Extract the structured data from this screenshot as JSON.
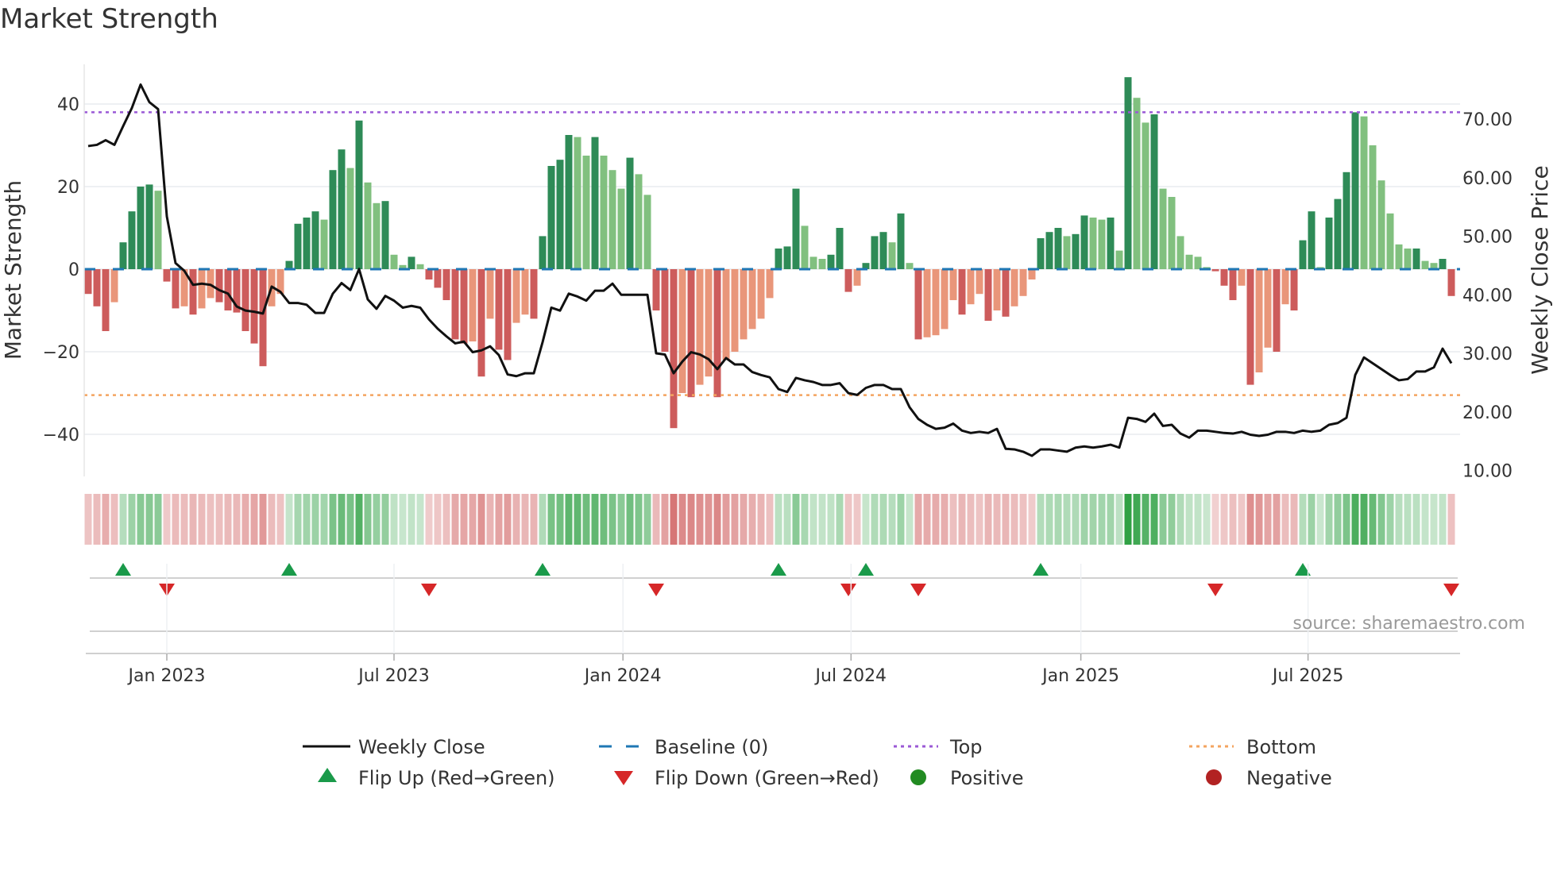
{
  "title": "Market Strength",
  "source": "source: sharemaestro.com",
  "chart_data": {
    "type": "bar",
    "title": "Market Strength",
    "ylabel": "Market Strength",
    "y2label": "Weekly Close Price",
    "ylim": [
      -50,
      50
    ],
    "y2lim": [
      10,
      78
    ],
    "yticks": [
      "40",
      "20",
      "0",
      "−20",
      "−40"
    ],
    "ytick_values": [
      40,
      20,
      0,
      -20,
      -40
    ],
    "y2ticks": [
      "70.00",
      "60.00",
      "50.00",
      "40.00",
      "30.00",
      "20.00",
      "10.00"
    ],
    "y2tick_values": [
      70,
      60,
      50,
      40,
      30,
      20,
      10
    ],
    "xticks": [
      {
        "label": "Jan 2023",
        "week": 9
      },
      {
        "label": "Jul 2023",
        "week": 35
      },
      {
        "label": "Jan 2024",
        "week": 61.2
      },
      {
        "label": "Jul 2024",
        "week": 87.3
      },
      {
        "label": "Jan 2025",
        "week": 113.6
      },
      {
        "label": "Jul 2025",
        "week": 139.6
      }
    ],
    "top_level": 38,
    "bottom_level": -30.5,
    "baseline": 0,
    "strength": [
      -6,
      -9,
      -15,
      -8,
      6.5,
      14,
      20,
      20.5,
      19,
      -3,
      -9.5,
      -9,
      -11,
      -9.5,
      -7,
      -8,
      -10,
      -10.5,
      -15,
      -18,
      -23.5,
      -9,
      -6,
      2,
      11,
      12.5,
      14,
      12,
      24,
      29,
      24.5,
      36,
      21,
      16,
      16.5,
      3.5,
      1,
      3,
      1.2,
      -2.5,
      -4.5,
      -7.5,
      -17,
      -18,
      -17.5,
      -26,
      -12,
      -19.5,
      -22,
      -13,
      -11,
      -12,
      8,
      25,
      26.5,
      32.5,
      32,
      27.5,
      32,
      27.5,
      24,
      19.5,
      27,
      23,
      18,
      -10,
      -20,
      -38.5,
      -30,
      -31,
      -28,
      -26,
      -31,
      -22,
      -20,
      -17,
      -14.5,
      -12,
      -7,
      5,
      5.5,
      19.5,
      10.5,
      3,
      2.5,
      3.5,
      10,
      -5.5,
      -4,
      1.5,
      8,
      9,
      6.5,
      13.5,
      1.5,
      -17,
      -16.5,
      -16,
      -14.5,
      -7.5,
      -11,
      -8.5,
      -6,
      -12.5,
      -10,
      -11.5,
      -9,
      -6.5,
      -2.5,
      7.5,
      9,
      10,
      8,
      8.5,
      13,
      12.5,
      12,
      12.5,
      4.5,
      46.5,
      41.5,
      35.5,
      37.5,
      19.5,
      17.5,
      8,
      3.5,
      3,
      0.5,
      -0.5,
      -4,
      -7.5,
      -4,
      -28,
      -25,
      -19,
      -20,
      -8.5,
      -10,
      7,
      14,
      0.5,
      12.5,
      17,
      23.5,
      38,
      37,
      30,
      21.5,
      13.5,
      6,
      5,
      5,
      2,
      1.5,
      2.5,
      -6.5
    ],
    "weekly_close": [
      65.4,
      65.6,
      66.4,
      65.6,
      68.8,
      71.9,
      75.9,
      72.9,
      71.7,
      53.4,
      45.4,
      44.1,
      41.7,
      41.9,
      41.7,
      40.8,
      40.2,
      38.0,
      37.3,
      37.1,
      36.8,
      41.4,
      40.5,
      38.6,
      38.6,
      38.3,
      36.9,
      36.9,
      40.2,
      42.0,
      40.8,
      44.4,
      39.2,
      37.6,
      39.8,
      39.0,
      37.8,
      38.1,
      37.8,
      35.8,
      34.2,
      32.9,
      31.7,
      32.0,
      30.2,
      30.5,
      31.2,
      29.7,
      26.4,
      26.1,
      26.6,
      26.6,
      31.9,
      37.8,
      37.3,
      40.2,
      39.7,
      39.0,
      40.7,
      40.7,
      41.9,
      40.0,
      40.0,
      40.0,
      40.0,
      30.0,
      29.8,
      26.6,
      28.6,
      30.2,
      29.8,
      29.0,
      27.3,
      29.2,
      28.1,
      28.1,
      26.8,
      26.3,
      25.9,
      23.9,
      23.4,
      25.8,
      25.4,
      25.1,
      24.6,
      24.6,
      24.9,
      23.2,
      22.9,
      24.1,
      24.6,
      24.6,
      23.9,
      23.9,
      20.8,
      18.8,
      17.8,
      17.1,
      17.3,
      18.0,
      16.8,
      16.4,
      16.6,
      16.4,
      17.1,
      13.7,
      13.6,
      13.2,
      12.5,
      13.6,
      13.6,
      13.4,
      13.2,
      13.9,
      14.1,
      13.9,
      14.1,
      14.4,
      13.9,
      19.0,
      18.8,
      18.3,
      19.7,
      17.6,
      17.8,
      16.3,
      15.6,
      16.8,
      16.8,
      16.6,
      16.4,
      16.3,
      16.6,
      16.1,
      15.9,
      16.1,
      16.6,
      16.6,
      16.4,
      16.8,
      16.6,
      16.8,
      17.8,
      18.1,
      19.0,
      26.3,
      29.3,
      28.3,
      27.3,
      26.3,
      25.4,
      25.6,
      26.9,
      26.9,
      27.6,
      30.8,
      28.3
    ],
    "legend": {
      "placement": "bottom",
      "items": [
        {
          "label": "Weekly Close",
          "symbol": "line"
        },
        {
          "label": "Baseline (0)",
          "symbol": "dash"
        },
        {
          "label": "Top",
          "symbol": "dot-purple"
        },
        {
          "label": "Bottom",
          "symbol": "dot-orange"
        },
        {
          "label": "Flip Up (Red→Green)",
          "symbol": "triangle-up"
        },
        {
          "label": "Flip Down (Green→Red)",
          "symbol": "triangle-down"
        },
        {
          "label": "Positive",
          "symbol": "circle-green"
        },
        {
          "label": "Negative",
          "symbol": "circle-red"
        }
      ]
    },
    "colors": {
      "pos_rising": "#2e8b57",
      "pos_falling": "#81c07f",
      "neg_falling": "#cd5c5c",
      "neg_rising": "#e9967a",
      "close": "#111111",
      "baseline": "#1f77b4",
      "top": "#9b59d6",
      "bottom": "#f4a460",
      "flip_up": "#1a9a4a",
      "flip_down": "#d62728",
      "positive": "#228b22",
      "negative": "#b22222"
    }
  }
}
